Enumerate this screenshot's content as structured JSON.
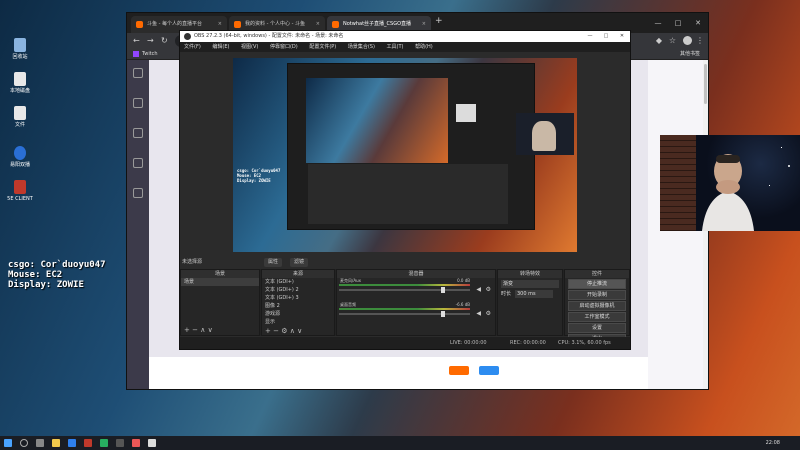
{
  "desktop": {
    "icons": [
      {
        "label": "回收站",
        "color": "#8ab4e0"
      },
      {
        "label": "本地磁盘",
        "color": "#e8e8e8"
      },
      {
        "label": "文件",
        "color": "#e8e8e8"
      },
      {
        "label": "易阳双播",
        "color": "#2a6fd6"
      },
      {
        "label": "5E CLIENT",
        "color": "#c0392b"
      }
    ]
  },
  "overlay": {
    "line1": "csgo: Cor`duoyu047",
    "line2": "Mouse: EC2",
    "line3": "Display: ZOWIE"
  },
  "browser": {
    "tabs": [
      {
        "label": "斗鱼 - 每个人的直播平台",
        "color": "#ff6a00"
      },
      {
        "label": "我的资料 - 个人中心 - 斗鱼",
        "color": "#ff6a00"
      },
      {
        "label": "Notwhat丝子直播_CSGO直播",
        "color": "#ff6a00"
      }
    ],
    "new_tab": "+",
    "bookmarks": [
      "Twitch"
    ],
    "bookmarks_right": "其他书签",
    "window_buttons": [
      "—",
      "□",
      "✕"
    ]
  },
  "obs": {
    "title": "OBS 27.2.3 (64-bit, windows) - 配置文件: 未命名 - 场景: 未命名",
    "menu": [
      "文件(F)",
      "编辑(E)",
      "视图(V)",
      "停靠窗口(D)",
      "配置文件(P)",
      "场景集合(S)",
      "工具(T)",
      "帮助(H)"
    ],
    "source_label": "未选择源",
    "props_label": "属性",
    "filters_label": "滤镜",
    "docks": {
      "scenes": {
        "title": "场景",
        "items": [
          "场景"
        ]
      },
      "sources": {
        "title": "来源",
        "items": [
          "文本 (GDI+)",
          "文本 (GDI+) 2",
          "文本 (GDI+) 3",
          "图像 2",
          "游戏源",
          "显示"
        ]
      },
      "mixer": {
        "title": "混音器",
        "channels": [
          {
            "name": "麦克风/Aux",
            "db": "0.0 dB"
          },
          {
            "name": "桌面音频",
            "db": "-6.6 dB"
          }
        ]
      },
      "transitions": {
        "title": "转场特效",
        "type": "渐变",
        "duration_label": "时长",
        "duration": "300 ms"
      },
      "controls": {
        "title": "控件",
        "buttons": [
          "停止推流",
          "开始录制",
          "启动虚拟摄像机",
          "工作室模式",
          "设置",
          "退出"
        ]
      }
    },
    "status": {
      "live": "LIVE: 00:00:00",
      "rec": "REC: 00:00:00",
      "cpu": "CPU: 3.1%, 60.00 fps"
    },
    "mini_overlay": [
      "csgo: Cor`duoyu047",
      "Mouse: EC2",
      "Display: ZOWIE"
    ]
  },
  "taskbar": {
    "clock": "22:08"
  }
}
